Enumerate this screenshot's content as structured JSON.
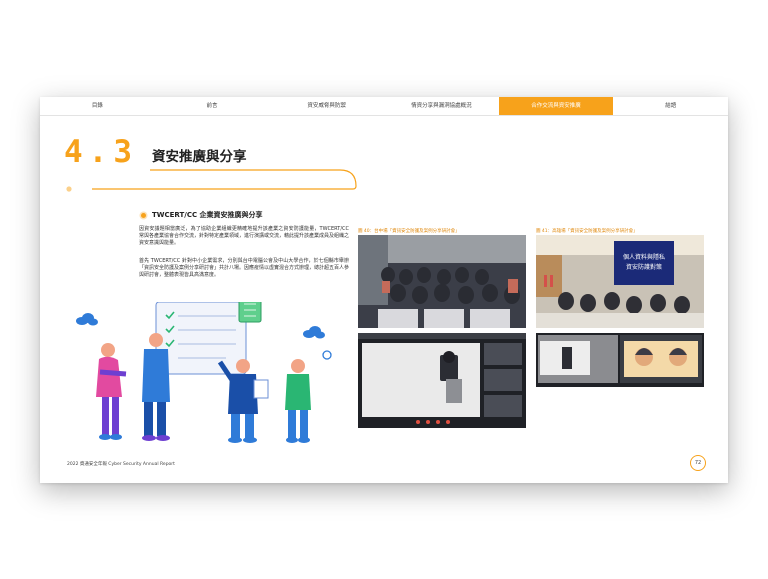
{
  "nav": {
    "items": [
      "目錄",
      "前言",
      "資安威脅與防禦",
      "情資分享與漏洞協處概況",
      "合作交流與資安推廣",
      "結語"
    ],
    "active_index": 4
  },
  "section": {
    "number": "4.3",
    "title": "資安推廣與分享"
  },
  "subsection": {
    "title": "TWCERT/CC 企業資安推廣與分享"
  },
  "paragraphs": [
    "因資安議題相當廣泛，為了協助企業組織更精確地提升該產業之資安防護能量，TWCERT/CC 常與各產業協會合作交流，針對特定產業領域，進行演講或交流，藉此提升該產業成員及組織之資安意識與能量。",
    "首先 TWCERT/CC 針對中小企業需求，分別與台中電腦公會及中山大學合作，於七個縣市舉辦「資訊安全防護及案例分享研討會」共計八場。因應疫情以虛實混合方式辦理，總計超五百人參與研討會，整體表現皆具高滿意度。"
  ],
  "captions": {
    "left": "圖 40：台中場「資訊安全防護及案例分享研討會」",
    "right": "圖 41：高雄場「資訊安全防護及案例分享研討會」"
  },
  "slide_text": {
    "line1": "個人資料與隱私",
    "line2": "資安防護對策"
  },
  "footer": {
    "text": "2022 資通安全年報 Cyber Security Annual Report",
    "page": "72"
  },
  "colors": {
    "accent": "#f7a21b"
  }
}
